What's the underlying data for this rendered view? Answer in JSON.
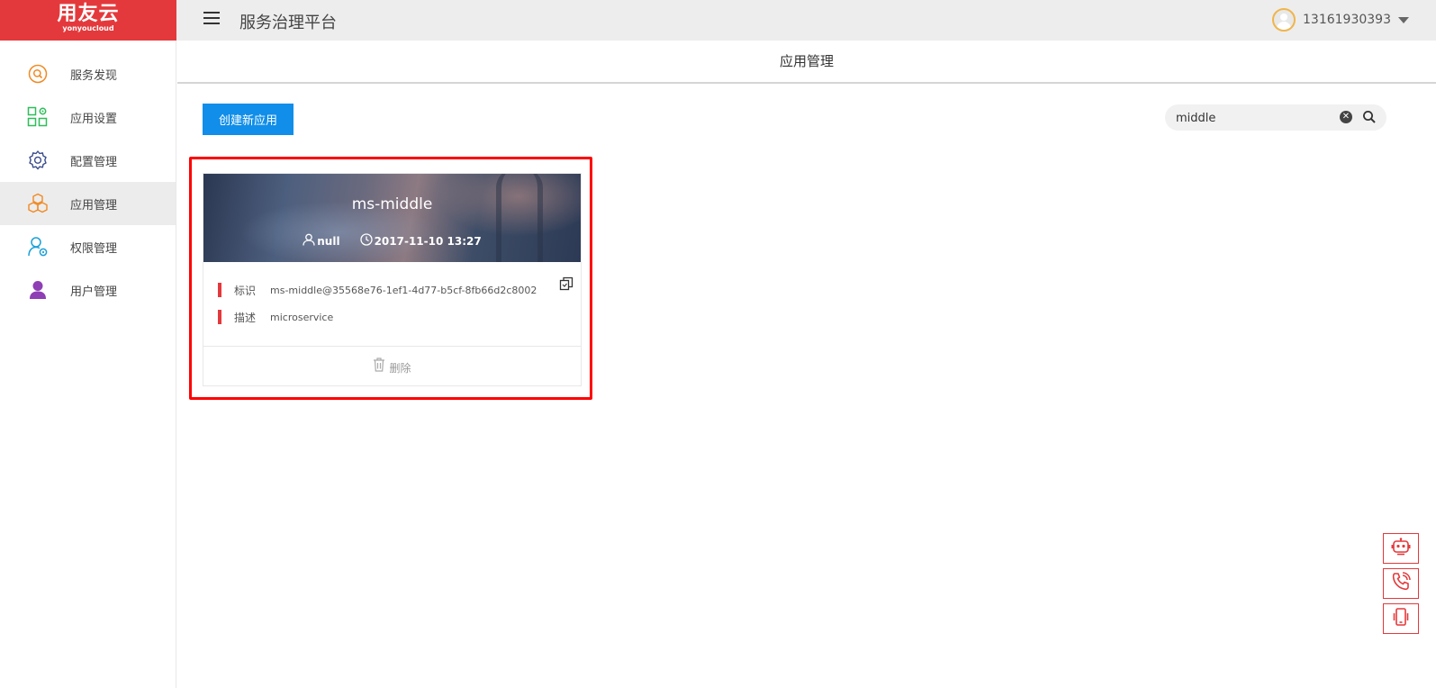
{
  "logo": {
    "main": "用友云",
    "sub": "yonyoucloud"
  },
  "header": {
    "platform_title": "服务治理平台",
    "username": "13161930393"
  },
  "sidebar": {
    "items": [
      {
        "label": "服务发现",
        "icon": "search-circle-icon"
      },
      {
        "label": "应用设置",
        "icon": "grid-gear-icon"
      },
      {
        "label": "配置管理",
        "icon": "gear-icon"
      },
      {
        "label": "应用管理",
        "icon": "cubes-icon",
        "active": true
      },
      {
        "label": "权限管理",
        "icon": "user-gear-icon"
      },
      {
        "label": "用户管理",
        "icon": "user-icon"
      }
    ]
  },
  "page": {
    "title": "应用管理"
  },
  "toolbar": {
    "create_label": "创建新应用"
  },
  "search": {
    "value": "middle"
  },
  "apps": [
    {
      "name": "ms-middle",
      "owner": "null",
      "created": "2017-11-10 13:27",
      "id_label": "标识",
      "id_value": "ms-middle@35568e76-1ef1-4d77-b5cf-8fb66d2c8002",
      "desc_label": "描述",
      "desc_value": "microservice",
      "delete_label": "删除"
    }
  ],
  "colors": {
    "brand": "#e4393c",
    "primary": "#108ee9",
    "highlight": "#ff0000"
  },
  "floating": [
    "robot-icon",
    "phone-icon",
    "mobile-icon"
  ]
}
